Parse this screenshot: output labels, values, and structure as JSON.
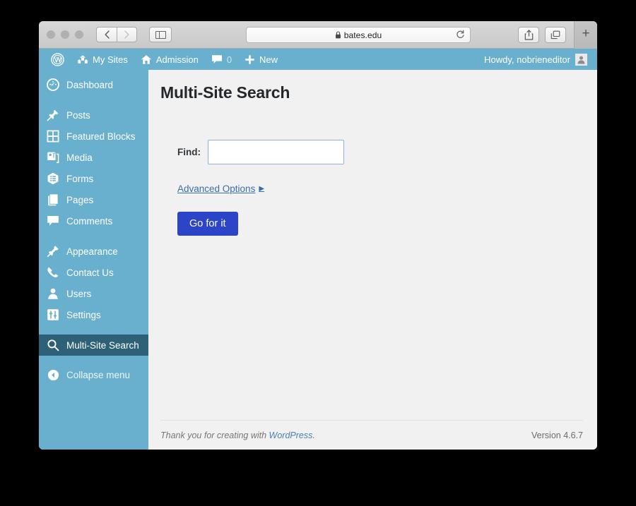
{
  "browser": {
    "url": "bates.edu",
    "lock_icon": "lock-icon",
    "reload_icon": "reload-icon",
    "back_icon": "chevron-left-icon",
    "forward_icon": "chevron-right-icon",
    "sidebar_icon": "sidebar-toggle-icon",
    "share_icon": "share-icon",
    "tabs_icon": "show-tabs-icon",
    "new_tab_label": "+"
  },
  "admin_bar": {
    "logo_icon": "wordpress-logo-icon",
    "my_sites": "My Sites",
    "site_name": "Admission",
    "comment_count": "0",
    "new_label": "New",
    "howdy": "Howdy, nobrieneditor",
    "avatar_icon": "user-avatar-icon"
  },
  "sidebar": {
    "items": [
      {
        "label": "Dashboard",
        "icon": "dashboard-icon",
        "current": false,
        "gap": false
      },
      {
        "label": "Posts",
        "icon": "pin-icon",
        "current": false,
        "gap": true
      },
      {
        "label": "Featured Blocks",
        "icon": "grid-icon",
        "current": false,
        "gap": false
      },
      {
        "label": "Media",
        "icon": "media-icon",
        "current": false,
        "gap": false
      },
      {
        "label": "Forms",
        "icon": "forms-icon",
        "current": false,
        "gap": false
      },
      {
        "label": "Pages",
        "icon": "pages-icon",
        "current": false,
        "gap": false
      },
      {
        "label": "Comments",
        "icon": "comment-icon",
        "current": false,
        "gap": false
      },
      {
        "label": "Appearance",
        "icon": "brush-icon",
        "current": false,
        "gap": true
      },
      {
        "label": "Contact Us",
        "icon": "phone-icon",
        "current": false,
        "gap": false
      },
      {
        "label": "Users",
        "icon": "user-icon",
        "current": false,
        "gap": false
      },
      {
        "label": "Settings",
        "icon": "settings-icon",
        "current": false,
        "gap": false
      },
      {
        "label": "Multi-Site Search",
        "icon": "search-icon",
        "current": true,
        "gap": true
      }
    ],
    "collapse_label": "Collapse menu",
    "collapse_icon": "collapse-arrow-icon"
  },
  "main": {
    "title": "Multi-Site Search",
    "find_label": "Find:",
    "find_value": "",
    "find_placeholder": "",
    "advanced_options_label": "Advanced Options",
    "advanced_options_arrow": "▶",
    "submit_label": "Go for it"
  },
  "footer": {
    "thanks_prefix": "Thank you for creating with ",
    "wordpress_link": "WordPress",
    "thanks_suffix": ".",
    "version": "Version 4.6.7"
  },
  "colors": {
    "admin_blue": "#69b0ce",
    "current_item": "#2d6178",
    "button_blue": "#2b44c8",
    "link_blue": "#3a6ea8",
    "content_bg": "#f1f1f1"
  }
}
